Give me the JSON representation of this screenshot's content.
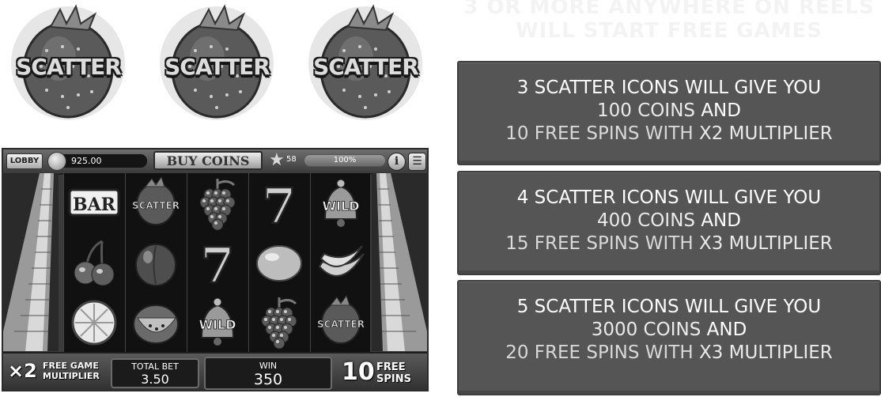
{
  "scatter_icons": [
    {
      "label": "SCATTER"
    },
    {
      "label": "SCATTER"
    },
    {
      "label": "SCATTER"
    }
  ],
  "free_games_hint": [
    "3 OR MORE ANYWHERE ON REELS",
    "WILL START FREE GAMES"
  ],
  "paytable": [
    {
      "line1": "3 SCATTER ICONS WILL GIVE YOU",
      "coins": "100 COINS",
      "and": "AND",
      "spins": "10 FREE SPINS WITH",
      "multiplier": "X2",
      "multiplier_word": "MULTIPLIER"
    },
    {
      "line1": "4 SCATTER ICONS WILL GIVE YOU",
      "coins": "400 COINS",
      "and": "AND",
      "spins": "15 FREE SPINS WITH",
      "multiplier": "X3",
      "multiplier_word": "MULTIPLIER"
    },
    {
      "line1": "5 SCATTER ICONS WILL GIVE YOU",
      "coins": "3000 COINS",
      "and": "AND",
      "spins": "20 FREE SPINS WITH",
      "multiplier": "X3",
      "multiplier_word": "MULTIPLIER"
    }
  ],
  "topbar": {
    "lobby": "LOBBY",
    "balance": "925.00",
    "buy_coins": "BUY COINS",
    "level": "58",
    "xp_percent": "100%",
    "xp_fraction": 1.0,
    "info": "i",
    "menu": "☰"
  },
  "reels": [
    [
      "bar",
      "cherries",
      "orange"
    ],
    [
      "scatter",
      "plum",
      "watermelon"
    ],
    [
      "grapes",
      "seven",
      "wild"
    ],
    [
      "seven",
      "lemon",
      "grapes"
    ],
    [
      "wild",
      "bananas",
      "scatter"
    ]
  ],
  "symbol_text": {
    "bar": "BAR",
    "scatter": "SCATTER",
    "wild": "WILD",
    "seven": "7"
  },
  "bottombar": {
    "multiplier": "×2",
    "multiplier_label": "FREE GAME MULTIPLIER",
    "total_bet_label": "TOTAL BET",
    "total_bet": "3.50",
    "win_label": "WIN",
    "win": "350",
    "free_spins": "10",
    "free_spins_label": "FREE SPINS"
  }
}
